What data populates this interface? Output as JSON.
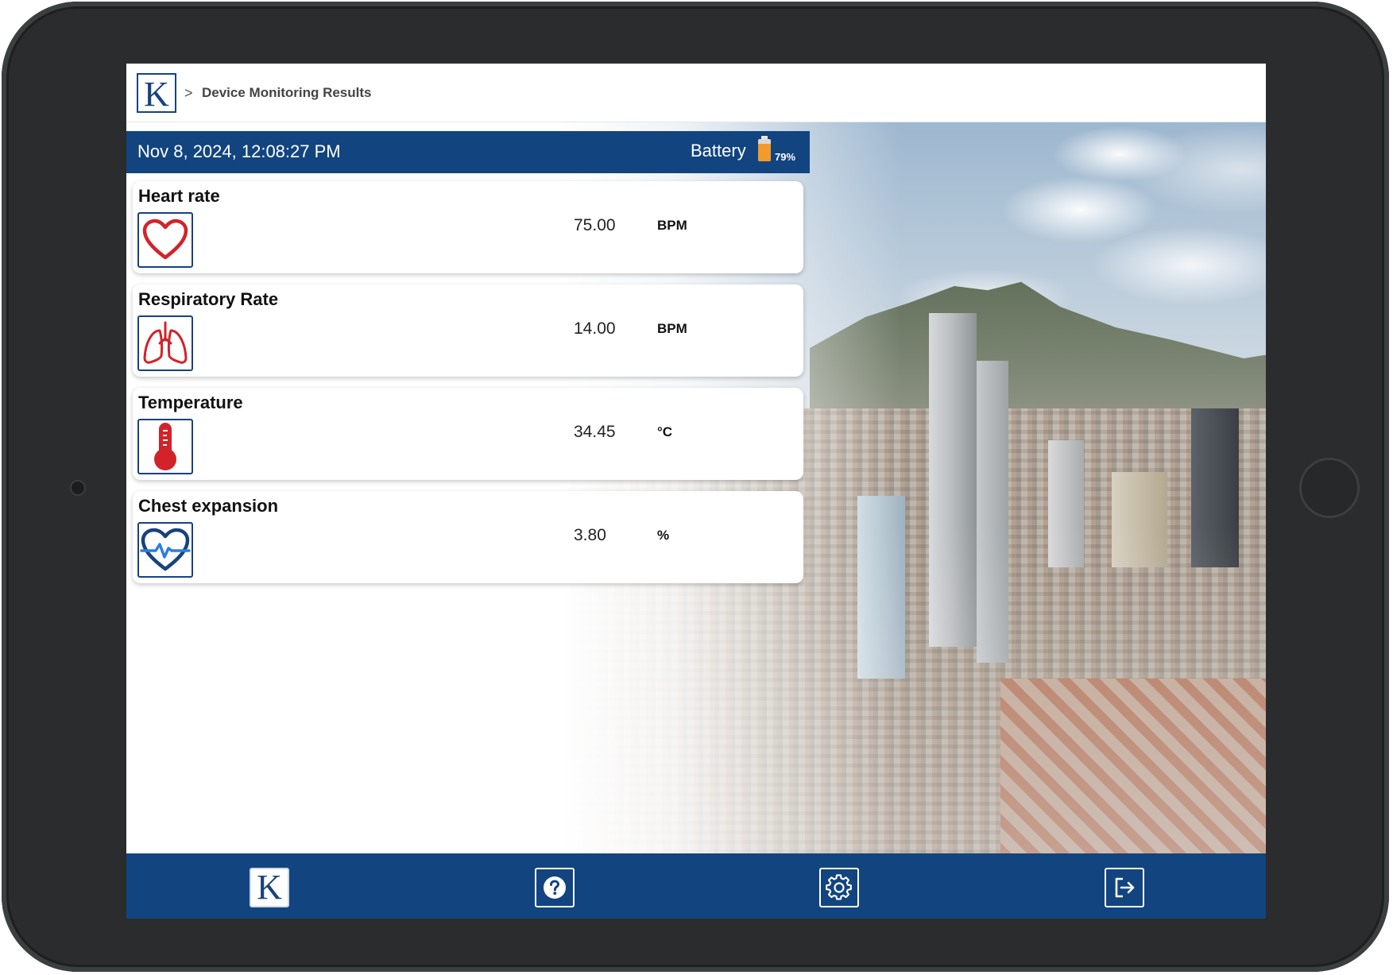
{
  "header": {
    "logo_letter": "K",
    "breadcrumb_separator": ">",
    "page_title": "Device Monitoring Results"
  },
  "status": {
    "timestamp": "Nov 8, 2024, 12:08:27 PM",
    "battery_label": "Battery",
    "battery_percent_text": "79%",
    "battery_level": 0.79,
    "battery_color": "#f39a2b"
  },
  "metrics": [
    {
      "title": "Heart rate",
      "value": "75.00",
      "unit": "BPM",
      "icon": "heart-icon",
      "color": "#d2232a"
    },
    {
      "title": "Respiratory Rate",
      "value": "14.00",
      "unit": "BPM",
      "icon": "lungs-icon",
      "color": "#d2232a"
    },
    {
      "title": "Temperature",
      "value": "34.45",
      "unit": "°C",
      "icon": "thermometer-icon",
      "color": "#d2232a"
    },
    {
      "title": "Chest expansion",
      "value": "3.80",
      "unit": "%",
      "icon": "heart-pulse-icon",
      "color": "#16437e"
    }
  ],
  "bottom_nav": [
    {
      "name": "home",
      "icon": "k-logo-icon",
      "letter": "K"
    },
    {
      "name": "help",
      "icon": "help-icon"
    },
    {
      "name": "settings",
      "icon": "gear-icon"
    },
    {
      "name": "logout",
      "icon": "logout-icon"
    }
  ],
  "colors": {
    "primary": "#12447f",
    "accent_red": "#d2232a",
    "background": "#ffffff"
  }
}
